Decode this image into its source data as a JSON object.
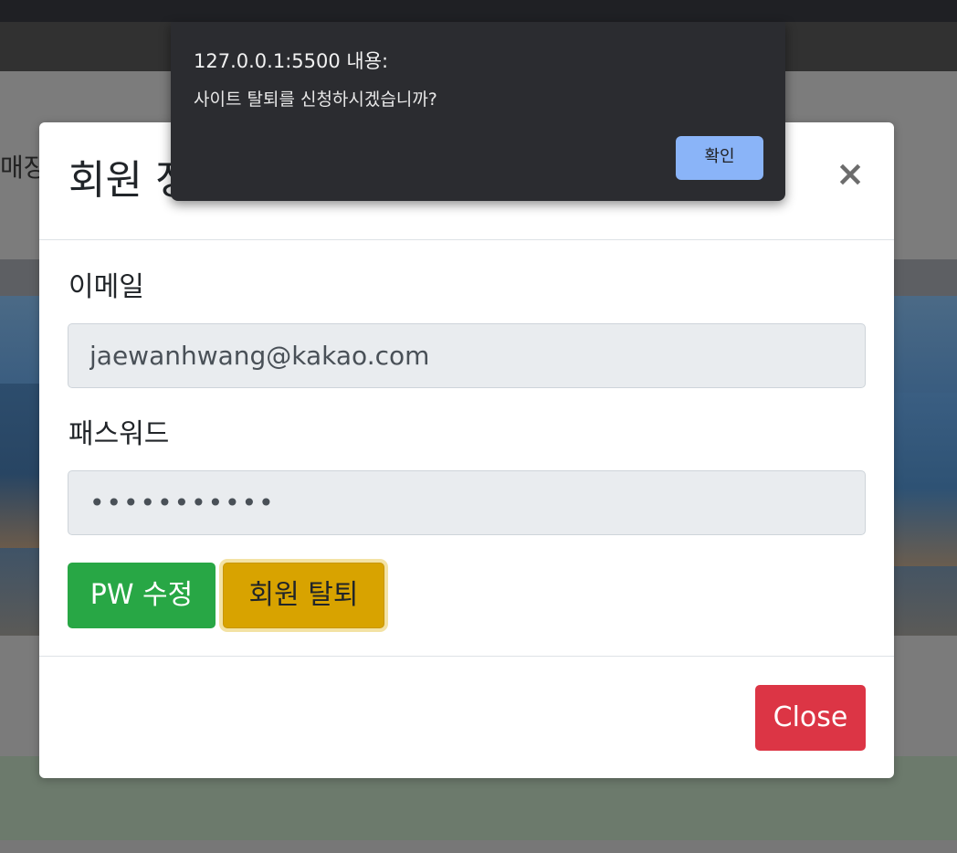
{
  "background": {
    "partial_label": "매장"
  },
  "modal": {
    "title": "회원 정보",
    "close_icon": "×",
    "email_label": "이메일",
    "email_value": "jaewanhwang@kakao.com",
    "password_label": "패스워드",
    "password_value": "•••••••••••",
    "change_pw_button": "PW 수정",
    "withdraw_button": "회원 탈퇴",
    "close_button": "Close"
  },
  "alert": {
    "origin": "127.0.0.1:5500 내용:",
    "message": "사이트 탈퇴를 신청하시겠습니까?",
    "ok_button": "확인"
  },
  "colors": {
    "change_pw_button": "#28a745",
    "withdraw_button": "#d8a300",
    "close_button": "#dc3545",
    "alert_ok_button": "#8ab4f8",
    "alert_background": "#2b2c30"
  }
}
